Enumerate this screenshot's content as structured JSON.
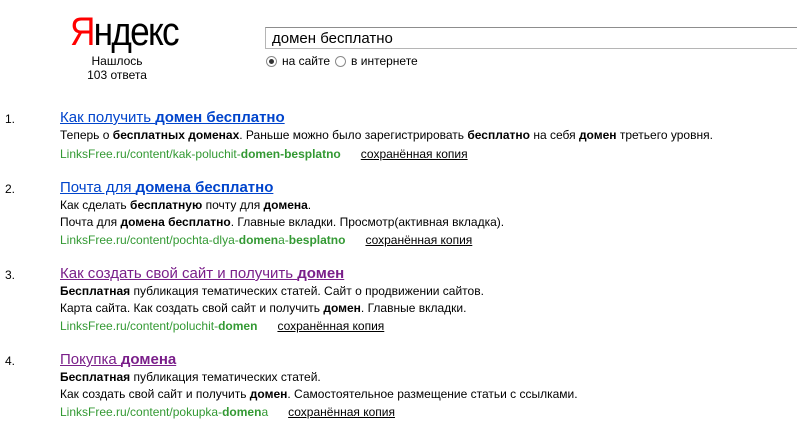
{
  "logo": {
    "first": "Я",
    "rest": "ндекс"
  },
  "found": {
    "line1": "Нашлось",
    "line2": "103 ответа"
  },
  "search": {
    "value": "домен бесплатно"
  },
  "scope": {
    "on_site": "на сайте",
    "on_internet": "в интернете",
    "selected": "on_site"
  },
  "cache_label": "сохранённая копия",
  "results": [
    {
      "number": "1.",
      "title_parts": [
        "Как получить ",
        "домен бесплатно"
      ],
      "snippet1_parts": [
        "Теперь о ",
        "бесплатных доменах",
        ". Раньше можно было зарегистрировать ",
        "бесплатно",
        " на себя ",
        "домен",
        " третьего уровня."
      ],
      "url_parts": [
        "LinksFree.ru/content/kak-poluchit-",
        "domen-besplatno"
      ]
    },
    {
      "number": "2.",
      "title_parts": [
        "Почта для ",
        "домена бесплатно"
      ],
      "snippet1_parts": [
        "Как сделать ",
        "бесплатную",
        " почту для ",
        "домена",
        "."
      ],
      "snippet2_parts": [
        "Почта для ",
        "домена бесплатно",
        ". Главные вкладки. Просмотр(активная вкладка)."
      ],
      "url_parts": [
        "LinksFree.ru/content/pochta-dlya-",
        "domen",
        "a-",
        "besplatno"
      ]
    },
    {
      "number": "3.",
      "title_parts": [
        "Как создать свой сайт и получить ",
        "домен"
      ],
      "snippet1_parts": [
        "Бесплатная",
        " публикация тематических статей. Сайт о продвижении сайтов."
      ],
      "snippet2_parts": [
        "Карта сайта. Как создать свой сайт и получить ",
        "домен",
        ". Главные вкладки."
      ],
      "url_parts": [
        "LinksFree.ru/content/poluchit-",
        "domen"
      ]
    },
    {
      "number": "4.",
      "title_parts": [
        "Покупка ",
        "домена"
      ],
      "snippet1_parts": [
        "Бесплатная",
        " публикация тематических статей."
      ],
      "snippet2_parts": [
        "Как создать свой сайт и получить ",
        "домен",
        ". Самостоятельное размещение статьи с ссылками."
      ],
      "url_parts": [
        "LinksFree.ru/content/pokupka-",
        "domen",
        "a"
      ]
    }
  ]
}
